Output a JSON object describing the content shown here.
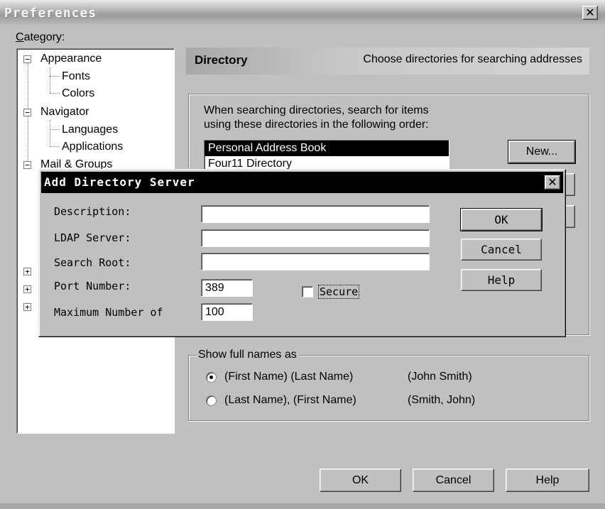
{
  "window": {
    "title": "Preferences",
    "close": "✕"
  },
  "category": {
    "label": "Category:",
    "items": [
      {
        "label": "Appearance",
        "level": 0,
        "expander": "−"
      },
      {
        "label": "Fonts",
        "level": 1
      },
      {
        "label": "Colors",
        "level": 1
      },
      {
        "label": "Navigator",
        "level": 0,
        "expander": "−"
      },
      {
        "label": "Languages",
        "level": 1
      },
      {
        "label": "Applications",
        "level": 1
      },
      {
        "label": "Mail & Groups",
        "level": 0,
        "expander": "−"
      }
    ],
    "collapsed_expander": "+"
  },
  "directory": {
    "header_title": "Directory",
    "header_desc": "Choose directories for searching addresses",
    "instruction_line1": "When searching directories, search for items",
    "instruction_line2": "using these directories in the following order:",
    "list": [
      "Personal Address Book",
      "Four11 Directory"
    ],
    "selected_index": 0,
    "new_button": "New..."
  },
  "show_names": {
    "label": "Show full names as",
    "options": [
      {
        "format": "(First Name)  (Last Name)",
        "example": "(John Smith)",
        "checked": true
      },
      {
        "format": "(Last Name),  (First Name)",
        "example": "(Smith, John)",
        "checked": false
      }
    ]
  },
  "footer": {
    "ok": "OK",
    "cancel": "Cancel",
    "help": "Help"
  },
  "dialog": {
    "title": "Add Directory Server",
    "close": "✕",
    "labels": {
      "description": "Description:",
      "ldap_server": "LDAP Server:",
      "search_root": "Search Root:",
      "port_number": "Port Number:",
      "max_hits": "Maximum Number of"
    },
    "values": {
      "description": "",
      "ldap_server": "",
      "search_root": "",
      "port_number": "389",
      "max_hits": "100"
    },
    "secure_label": "Secure",
    "secure_checked": false,
    "ok": "OK",
    "cancel": "Cancel",
    "help": "Help"
  }
}
